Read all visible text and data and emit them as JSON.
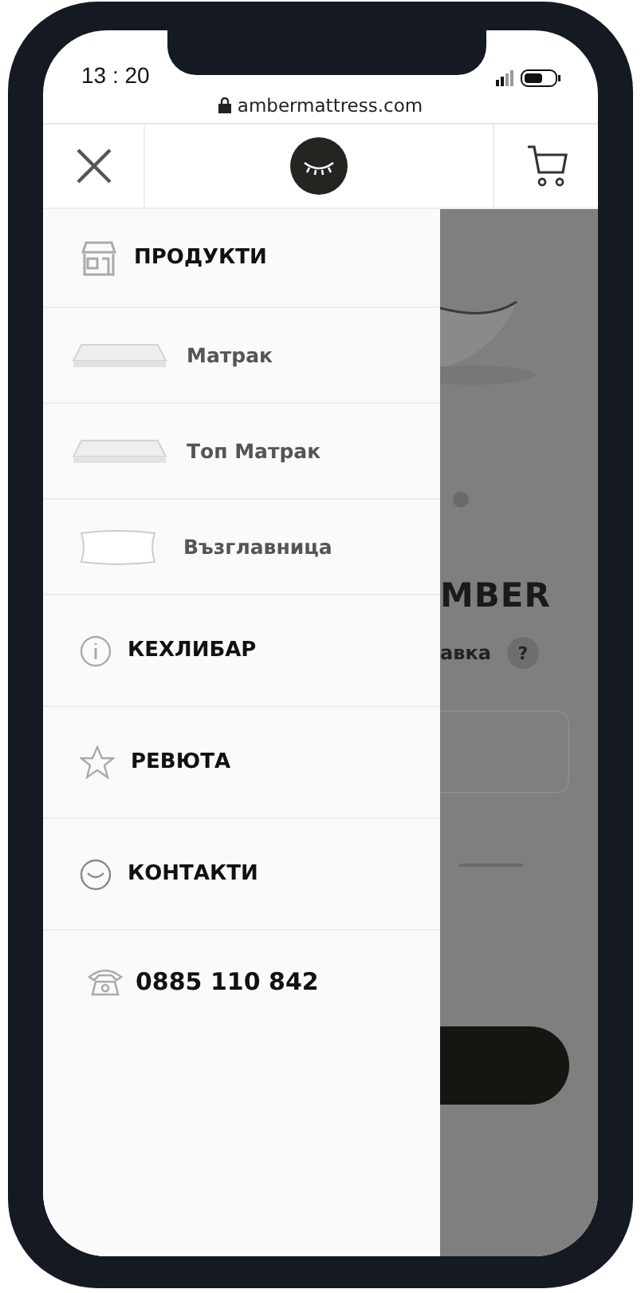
{
  "status_bar": {
    "time": "13 : 20"
  },
  "address_bar": {
    "url": "ambermattress.com"
  },
  "menu": [
    {
      "kind": "heading",
      "label": "ПРОДУКТИ",
      "children": [
        {
          "label": "Матрак"
        },
        {
          "label": "Топ Матрак"
        },
        {
          "label": "Възглавница"
        }
      ]
    },
    {
      "kind": "heading",
      "label": "КЕХЛИБАР"
    },
    {
      "kind": "heading",
      "label": "РЕВЮТА"
    },
    {
      "kind": "heading",
      "label": "КОНТАКТИ"
    },
    {
      "kind": "phone",
      "label": "0885 110 842"
    }
  ],
  "background_page": {
    "heading_fragment": "MBER",
    "delivery_fragment": "авка",
    "help_badge": "?"
  }
}
